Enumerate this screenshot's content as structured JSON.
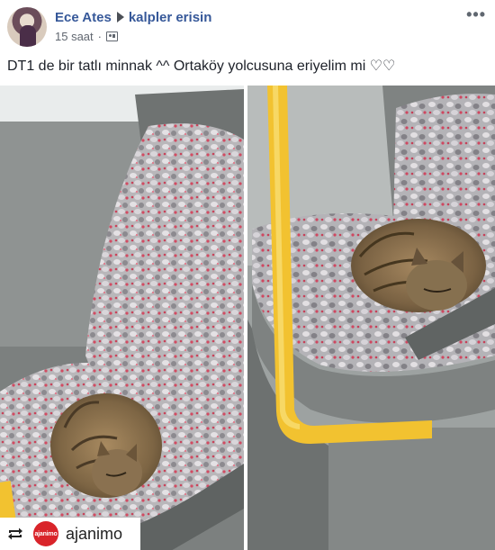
{
  "post": {
    "author": "Ece Ates",
    "target_page": "kalpler erisin",
    "time": "15 saat",
    "separator": "·",
    "audience_icon": "public-globe-icon",
    "more_icon": "more-options-icon",
    "caption": "DT1 de bir tatlı minnak ^^ Ortaköy yolcusuna eriyelim mi ♡♡"
  },
  "photos": [
    {
      "subject": "tabby cat sleeping on bus seat",
      "view": "left"
    },
    {
      "subject": "tabby cat sleeping on bus seat",
      "view": "right"
    }
  ],
  "repost": {
    "icon": "repost-icon",
    "logo_text": "ajanimo",
    "brand": "ajanimo"
  },
  "colors": {
    "link": "#365899",
    "meta": "#616770",
    "pole": "#f2c230",
    "logo": "#d9242a"
  }
}
